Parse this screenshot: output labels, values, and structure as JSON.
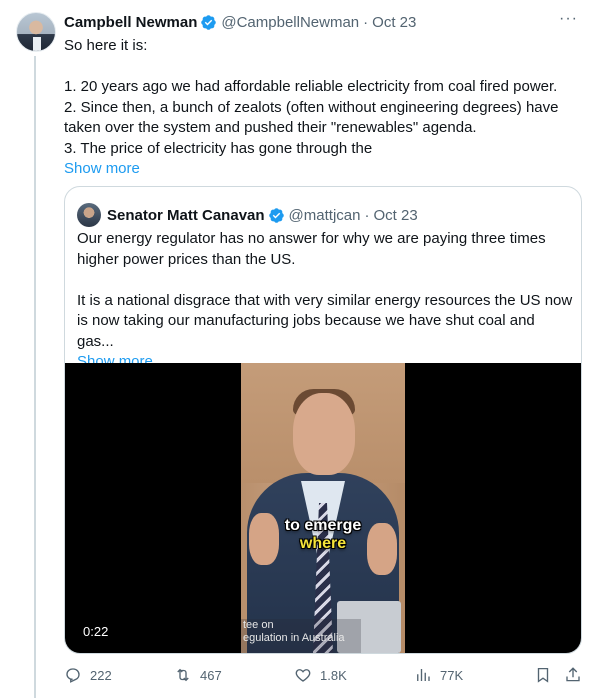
{
  "tweet": {
    "author_name": "Campbell Newman",
    "handle": "@CampbellNewman",
    "separator": "·",
    "date": "Oct 23",
    "more_glyph": "···",
    "lines": [
      "So here it is:",
      "",
      "1. 20 years ago we had affordable reliable electricity from coal fired power.",
      "2. Since then, a bunch of zealots (often without engineering degrees) have taken over the system and pushed their \"renewables\" agenda.",
      "3. The price of electricity has gone through the"
    ],
    "show_more": "Show more"
  },
  "quote": {
    "author_name": "Senator Matt Canavan",
    "handle": "@mattjcan",
    "separator": "·",
    "date": "Oct 23",
    "paragraphs": [
      "Our energy regulator has no answer for why we are paying three times higher power prices than the US.",
      "It is a national disgrace that with very similar energy resources the US now is now taking our manufacturing jobs because we have shut coal and gas..."
    ],
    "show_more": "Show more",
    "video": {
      "caption_line1": "to emerge",
      "caption_line2": "where",
      "nameplate_line1": "tee on",
      "nameplate_line2": "egulation in Australia",
      "duration": "0:22"
    }
  },
  "actions": {
    "replies": "222",
    "retweets": "467",
    "likes": "1.8K",
    "views": "77K"
  },
  "colors": {
    "accent": "#1d9bf0",
    "muted": "#536471",
    "border": "#cfd9de",
    "caption_highlight": "#f5e43a"
  },
  "icons": [
    "verified-badge-icon",
    "more-options-icon",
    "reply-icon",
    "retweet-icon",
    "like-icon",
    "views-icon",
    "bookmark-icon",
    "share-icon"
  ]
}
